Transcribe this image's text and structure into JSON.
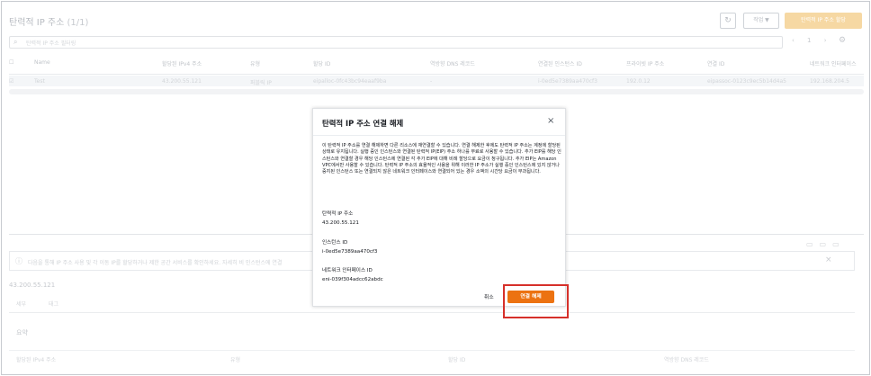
{
  "background": {
    "title": "탄력적 IP 주소",
    "count": "(1/1)",
    "refresh_icon": "refresh-icon",
    "actions_label": "작업 ▼",
    "allocate_label": "탄력적 IP 주소 할당",
    "search_placeholder": "탄력적 IP 주소 필터링",
    "pager": "‹ 1 ›",
    "columns": [
      "Name",
      "할당된 IPv4 주소",
      "유형",
      "할당 ID",
      "역방향 DNS 레코드",
      "연결된 인스턴스 ID",
      "프라이빗 IP 주소",
      "연결 ID",
      "네트워크 인터페이스"
    ],
    "row": [
      "Test",
      "43.200.55.121",
      "퍼블릭 IP",
      "eipalloc-0fc43bc94eaaf9ba",
      "-",
      "i-0ed5e7389aa470cf3",
      "192.0.12",
      "eipassoc-0123c9ec5b14d4a5",
      "192.168.204.5"
    ],
    "info_text": "다음을 통해 IP 주소 사용 및 각 이동 IP를 할당하거나 제한 공간 서비스를 확인하세요. 자세히 비 인스턴스에 연결",
    "selected_ip": "43.200.55.121",
    "tabs": [
      "세부",
      "태그"
    ],
    "summary_title": "요약",
    "summary_cols": [
      "할당된 IPv4 주소",
      "유형",
      "할당 ID",
      "역방향 DNS 레코드"
    ]
  },
  "modal": {
    "title": "탄력적 IP 주소 연결 해제",
    "description": "이 탄력적 IP 주소를 연결 해제하면 다른 리소스에 재연결할 수 있습니다. 연결 해제한 후에도 탄력적 IP 주소는 계정에 할당된 상태로 유지됩니다. 실행 중인 인스턴스와 연결된 탄력적 IP(EIP) 주소 하나를 무료로 사용할 수 있습니다. 추가 EIP를 해당 인스턴스와 연결할 경우 해당 인스턴스에 연결된 각 추가 EIP에 대해 비례 할당으로 요금이 청구됩니다. 추가 EIP는 Amazon VPC에서만 사용할 수 있습니다. 탄력적 IP 주소의 효율적인 사용을 위해 이러한 IP 주소가 실행 중인 인스턴스에 있지 않거나 중지된 인스턴스 또는 연결되지 않은 네트워크 인터페이스와 연결되어 있는 경우 소액의 시간당 요금이 부과됩니다.",
    "fields": [
      {
        "label": "탄력적 IP 주소",
        "value": "43.200.55.121"
      },
      {
        "label": "인스턴스 ID",
        "value": "i-0ed5e7389aa470cf3"
      },
      {
        "label": "네트워크 인터페이스 ID",
        "value": "eni-039f304adcc62abdc"
      }
    ],
    "cancel_label": "취소",
    "confirm_label": "연결 해제",
    "close_icon": "close-icon",
    "accent_color": "#ec7211",
    "highlight_color": "#d6302a"
  }
}
